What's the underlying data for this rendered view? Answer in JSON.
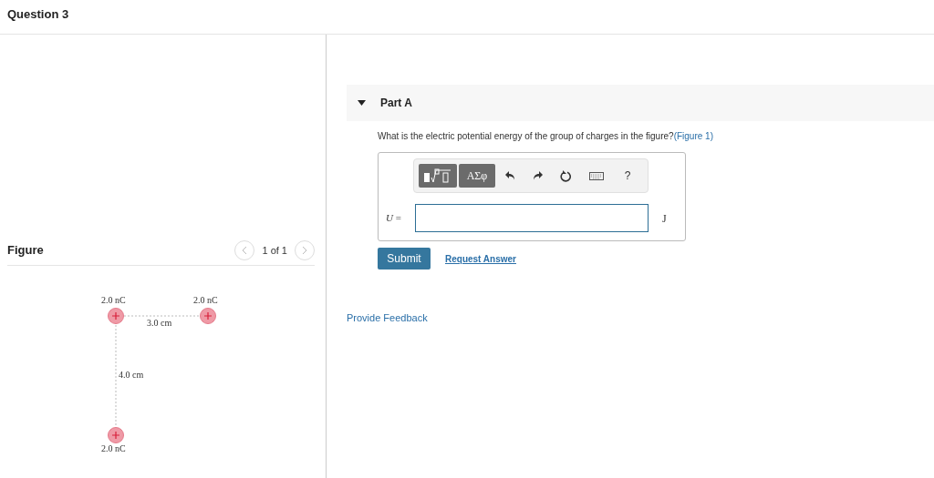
{
  "question_title": "Question 3",
  "figure_panel": {
    "title": "Figure",
    "pager": "1 of 1",
    "prev_disabled": true,
    "next_disabled": true,
    "labels": {
      "top_left_charge": "2.0 nC",
      "top_right_charge": "2.0 nC",
      "bottom_charge": "2.0 nC",
      "horizontal_distance": "3.0 cm",
      "vertical_distance": "4.0 cm"
    }
  },
  "part": {
    "title": "Part A",
    "expanded": true,
    "question": "What is the electric potential energy of the group of charges in the figure?",
    "figure_link": "(Figure 1)",
    "toolbar": {
      "greek_button": "ΑΣφ",
      "help_button": "?"
    },
    "answer": {
      "variable": "*U* =",
      "unit": "J"
    },
    "submit": "Submit",
    "request_answer": "Request Answer"
  },
  "feedback_link": "Provide Feedback"
}
